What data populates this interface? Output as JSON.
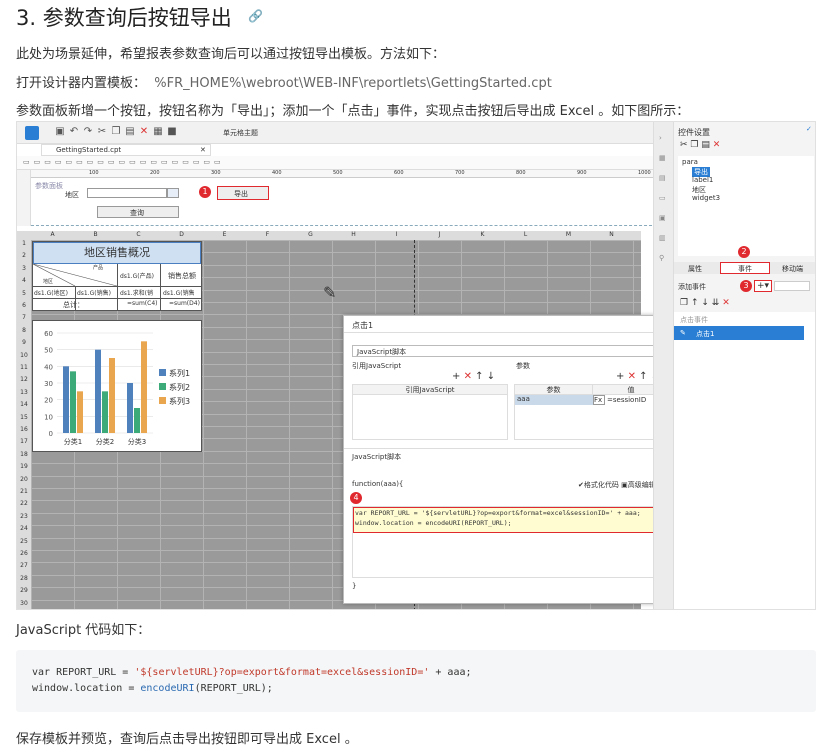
{
  "heading": "3. 参数查询后按钮导出",
  "intro": "此处为场景延伸，希望报表参数查询后可以通过按钮导出模板。方法如下：",
  "open_label": "打开设计器内置模板：",
  "open_path": "%FR_HOME%\\webroot\\WEB-INF\\reportlets\\GettingStarted.cpt",
  "step": "参数面板新增一个按钮，按钮名称为「导出」；添加一个「点击」事件，实现点击按钮后导出成 Excel 。如下图所示：",
  "screenshot": {
    "toolbar_text": "单元格主题",
    "tab": "GettingStarted.cpt",
    "param_area": "参数面板",
    "query_label": "地区",
    "export_btn": "导出",
    "query_btn": "查询",
    "ruler": [
      "100",
      "200",
      "300",
      "400",
      "500",
      "600",
      "700",
      "800",
      "900",
      "1000"
    ],
    "cols": [
      "A",
      "B",
      "C",
      "D",
      "E",
      "F",
      "G",
      "H",
      "I",
      "J",
      "K",
      "L",
      "M",
      "N"
    ],
    "rows": [
      "1",
      "2",
      "3",
      "4",
      "5",
      "6",
      "7",
      "8",
      "9",
      "10",
      "11",
      "12",
      "13",
      "14",
      "15",
      "16",
      "17",
      "18",
      "19",
      "20",
      "21",
      "22",
      "23",
      "24",
      "25",
      "26",
      "27",
      "28",
      "29",
      "30"
    ],
    "report_title": "地区销售概况",
    "cells": {
      "r3c": "ds1.G(产品)",
      "r3d": "销售总额",
      "r4a": "ds1.G(地区)",
      "r4b": "ds1.G(销售)",
      "r4c": "ds1.求和(销",
      "r4d": "ds1.G(销售",
      "r5b": "总计：",
      "r5c": "=sum(C4)",
      "r5d": "=sum(D4)",
      "diag1": "产品",
      "diag2": "地区"
    },
    "chart_data": {
      "type": "bar",
      "categories": [
        "分类1",
        "分类2",
        "分类3"
      ],
      "series": [
        {
          "name": "系列1",
          "color": "#4f81bd",
          "values": [
            40,
            50,
            30
          ]
        },
        {
          "name": "系列2",
          "color": "#3daa7a",
          "values": [
            37,
            25,
            15
          ]
        },
        {
          "name": "系列3",
          "color": "#e9a64e",
          "values": [
            25,
            45,
            55
          ]
        }
      ],
      "ylim": [
        0,
        60
      ],
      "yticks": [
        "0",
        "10",
        "20",
        "30",
        "40",
        "50",
        "60"
      ]
    },
    "dialog": {
      "title": "点击1",
      "select": "JavaScript脚本",
      "ref_js": "引用JavaScript",
      "params": "参数",
      "ref_js_col": "引用JavaScript",
      "param_col": "参数",
      "value_col": "值",
      "param_name": "aaa",
      "param_value": "=sessionID",
      "script_section": "JavaScript脚本",
      "fn_sig": "function(aaa){",
      "format_code": "格式化代码",
      "advanced_edit": "高级编辑",
      "code1": "var REPORT_URL = '${servletURL}?op=export&format=excel&sessionID=' + aaa;",
      "code2": "window.location = encodeURI(REPORT_URL);",
      "close_brace": "}"
    },
    "right_panel": {
      "title": "控件设置",
      "tree": [
        "para",
        "导出",
        "label1",
        "地区",
        "widget3"
      ],
      "tabs": [
        "属性",
        "事件",
        "移动端"
      ],
      "add_event": "添加事件",
      "event_group": "点击事件",
      "event_item": "点击1"
    },
    "badges": [
      "1",
      "2",
      "3",
      "4"
    ]
  },
  "code_title": "JavaScript 代码如下：",
  "code": {
    "kw1": "var",
    "var1": " REPORT_URL = ",
    "str1": "'${servletURL}?op=export&format=excel&sessionID='",
    "rest1": " + aaa;",
    "l2a": "window.location = ",
    "fn": "encodeURI",
    "l2b": "(REPORT_URL);"
  },
  "outro": "保存模板并预览，查询后点击导出按钮即可导出成 Excel 。"
}
